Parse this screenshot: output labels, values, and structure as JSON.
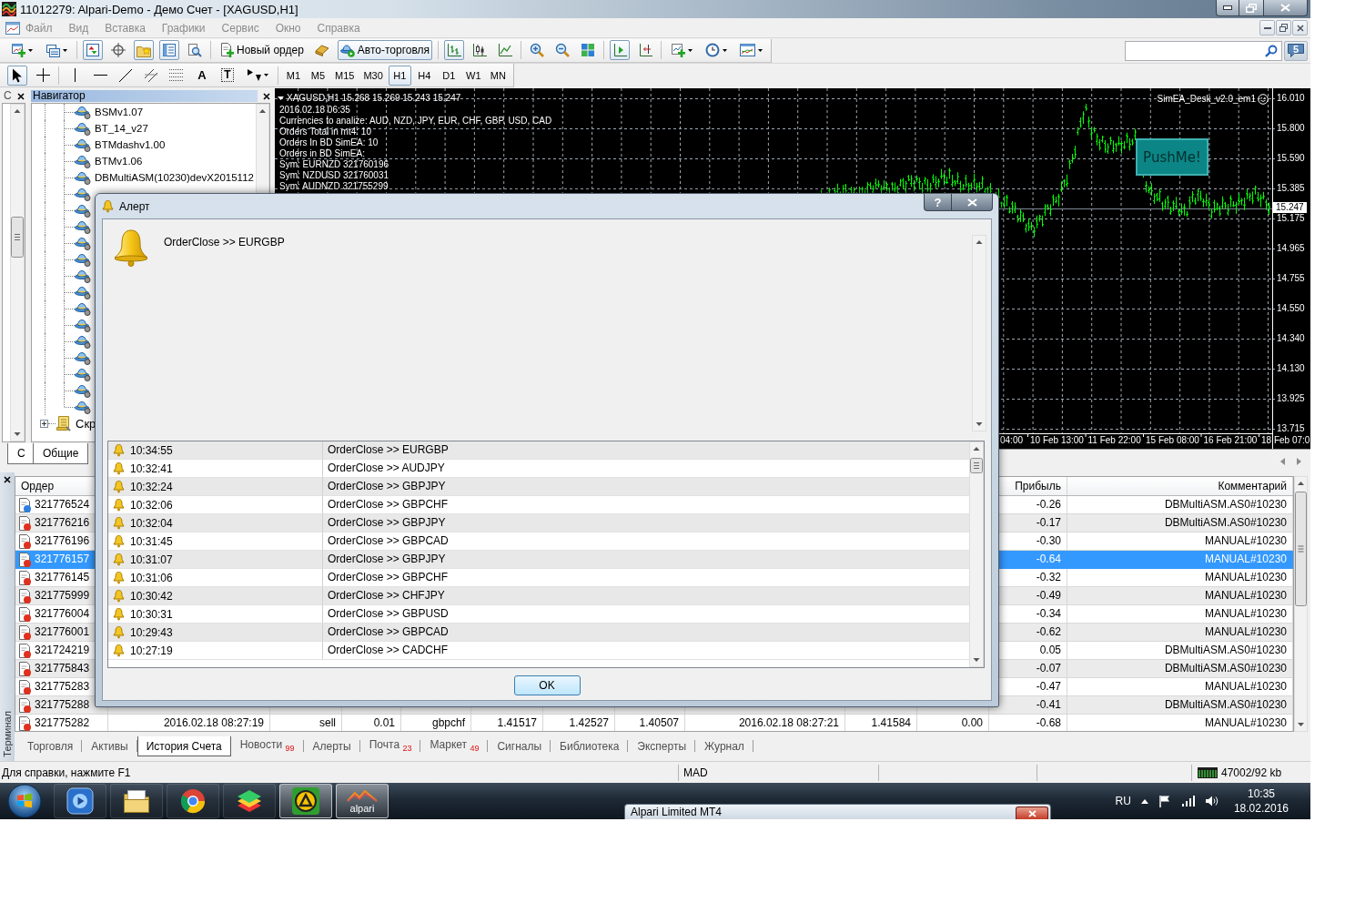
{
  "window": {
    "title": "11012279: Alpari-Demo - Демо Счет - [XAGUSD,H1]"
  },
  "menu": [
    {
      "label": "Файл",
      "disabled": true
    },
    {
      "label": "Вид",
      "disabled": true
    },
    {
      "label": "Вставка",
      "disabled": true
    },
    {
      "label": "Графики",
      "disabled": true
    },
    {
      "label": "Сервис",
      "disabled": true
    },
    {
      "label": "Окно",
      "disabled": true
    },
    {
      "label": "Справка",
      "disabled": true
    }
  ],
  "toolbar": {
    "view_toggles": [
      {
        "on": true
      },
      {
        "on": false
      },
      {
        "on": true
      },
      {
        "on": true
      },
      {
        "on": false
      }
    ],
    "new_order": "Новый ордер",
    "auto_trading": {
      "label": "Авто-торговля",
      "on": true
    },
    "chart_types": [
      {
        "selected": true
      },
      {
        "selected": false
      },
      {
        "selected": false
      }
    ],
    "auto_scroll": {
      "on": true
    },
    "chart_shift": {
      "on": false
    },
    "messages": "5"
  },
  "drawing_tools": [
    {
      "kind": "cursor",
      "selected": true
    },
    {
      "kind": "crosshair",
      "selected": false
    },
    {
      "kind": "vertical-line",
      "selected": false
    },
    {
      "kind": "horizontal-line",
      "selected": false
    },
    {
      "kind": "trend-line",
      "selected": false
    },
    {
      "kind": "channel",
      "selected": false
    },
    {
      "kind": "fibo",
      "selected": false
    },
    {
      "kind": "text",
      "label": "A",
      "selected": false
    },
    {
      "kind": "label",
      "label": "T",
      "selected": false
    },
    {
      "kind": "arrows",
      "selected": false
    }
  ],
  "timeframes": [
    {
      "label": "M1",
      "selected": false
    },
    {
      "label": "M5",
      "selected": false
    },
    {
      "label": "M15",
      "selected": false
    },
    {
      "label": "M30",
      "selected": false
    },
    {
      "label": "H1",
      "selected": true
    },
    {
      "label": "H4",
      "selected": false
    },
    {
      "label": "D1",
      "selected": false
    },
    {
      "label": "W1",
      "selected": false
    },
    {
      "label": "MN",
      "selected": false
    }
  ],
  "market_watch": {
    "title": "С",
    "tabs": [
      {
        "label": "С",
        "selected": true
      }
    ]
  },
  "navigator": {
    "title": "Навигатор",
    "items": [
      {
        "kind": "expert",
        "label": "BSMv1.07"
      },
      {
        "kind": "expert",
        "label": "BT_14_v27"
      },
      {
        "kind": "expert",
        "label": "BTMdashv1.00"
      },
      {
        "kind": "expert",
        "label": "BTMv1.06"
      },
      {
        "kind": "expert",
        "label": "DBMultiASM(10230)devX2015112"
      },
      {
        "kind": "expert"
      },
      {
        "kind": "expert"
      },
      {
        "kind": "expert"
      },
      {
        "kind": "expert"
      },
      {
        "kind": "expert"
      },
      {
        "kind": "expert"
      },
      {
        "kind": "expert"
      },
      {
        "kind": "expert"
      },
      {
        "kind": "expert"
      },
      {
        "kind": "expert"
      },
      {
        "kind": "expert"
      },
      {
        "kind": "expert"
      },
      {
        "kind": "expert"
      },
      {
        "kind": "expert"
      },
      {
        "kind": "folder",
        "label": "Скр",
        "expanded": false
      }
    ],
    "tabs": [
      {
        "label": "Общие",
        "selected": true
      }
    ]
  },
  "chart": {
    "header": "XAGUSD,H1 15.268 15.269 15.243 15.247",
    "info_lines": [
      "2016.02.18 06:35",
      "Currencies to analize: AUD, NZD, JPY, EUR, CHF, GBP, USD, CAD",
      "Orders Total in mt4: 10",
      "Orders In BD SimEA: 10",
      "Orders in BD SimEA:",
      "Sym: EURNZD 321760196",
      "Sym: NZDUSD 321760031",
      "Sym: AUDNZD 321755299"
    ],
    "expert": "SimEA_Desk_v2.0_em1",
    "button": "PushMe!",
    "price_labels": [
      "16.010",
      "15.800",
      "15.590",
      "15.385",
      "15.175",
      "14.965",
      "14.755",
      "14.550",
      "14.340",
      "14.130",
      "13.925",
      "13.715"
    ],
    "current_price": "15.247",
    "time_labels": [
      "04:00",
      "10 Feb 13:00",
      "11 Feb 22:00",
      "15 Feb 08:00",
      "16 Feb 21:00",
      "18 Feb 07:0"
    ]
  },
  "terminal": {
    "label": "Терминал",
    "columns": {
      "order": "Ордер",
      "profit": "Прибыль",
      "comment": "Комментарий"
    },
    "rows": [
      {
        "order": "321776524",
        "color": "#2f7fe0",
        "profit": "-0.26",
        "comment": "DBMultiASM.AS0#10230",
        "selected": false
      },
      {
        "order": "321776216",
        "color": "#e0301e",
        "profit": "-0.17",
        "comment": "DBMultiASM.AS0#10230",
        "selected": false
      },
      {
        "order": "321776196",
        "color": "#e0301e",
        "profit": "-0.30",
        "comment": "MANUAL#10230",
        "selected": false
      },
      {
        "order": "321776157",
        "color": "#e0301e",
        "profit": "-0.64",
        "comment": "MANUAL#10230",
        "selected": true
      },
      {
        "order": "321776145",
        "color": "#e0301e",
        "profit": "-0.32",
        "comment": "MANUAL#10230",
        "selected": false
      },
      {
        "order": "321775999",
        "color": "#e0301e",
        "profit": "-0.49",
        "comment": "MANUAL#10230",
        "selected": false
      },
      {
        "order": "321776004",
        "color": "#e0301e",
        "profit": "-0.34",
        "comment": "MANUAL#10230",
        "selected": false
      },
      {
        "order": "321776001",
        "color": "#e0301e",
        "profit": "-0.62",
        "comment": "MANUAL#10230",
        "selected": false
      },
      {
        "order": "321724219",
        "color": "#e0301e",
        "profit": "0.05",
        "comment": "DBMultiASM.AS0#10230",
        "selected": false
      },
      {
        "order": "321775843",
        "color": "#e0301e",
        "profit": "-0.07",
        "comment": "DBMultiASM.AS0#10230",
        "selected": false
      },
      {
        "order": "321775283",
        "color": "#e0301e",
        "profit": "-0.47",
        "comment": "MANUAL#10230",
        "selected": false
      },
      {
        "order": "321775288",
        "color": "#e0301e",
        "profit": "-0.41",
        "comment": "DBMultiASM.AS0#10230",
        "selected": false
      },
      {
        "order": "321775282",
        "color": "#e0301e",
        "column_2": "2016.02.18 08:27:19",
        "column_3": "sell",
        "column_4": "0.01",
        "column_5": "gbpchf",
        "column_6": "1.41517",
        "column_7": "1.42527",
        "column_8": "1.40507",
        "column_9": "2016.02.18 08:27:21",
        "column_10": "1.41584",
        "column_11": "0.00",
        "profit": "-0.68",
        "comment": "MANUAL#10230",
        "selected": false
      }
    ],
    "tabs": [
      {
        "label": "Торговля",
        "selected": false
      },
      {
        "label": "Активы",
        "selected": false
      },
      {
        "label": "История Счета",
        "selected": true
      },
      {
        "label": "Новости",
        "count": "99",
        "selected": false
      },
      {
        "label": "Алерты",
        "selected": false
      },
      {
        "label": "Почта",
        "count": "23",
        "selected": false
      },
      {
        "label": "Маркет",
        "count": "49",
        "selected": false
      },
      {
        "label": "Сигналы",
        "selected": false
      },
      {
        "label": "Библиотека",
        "selected": false
      },
      {
        "label": "Эксперты",
        "selected": false
      },
      {
        "label": "Журнал",
        "selected": false
      }
    ]
  },
  "alert": {
    "title": "Алерт",
    "help": "?",
    "message": "OrderClose >> EURGBP",
    "rows": [
      {
        "time": "10:34:55",
        "text": "OrderClose >> EURGBP"
      },
      {
        "time": "10:32:41",
        "text": "OrderClose >> AUDJPY"
      },
      {
        "time": "10:32:24",
        "text": "OrderClose >> GBPJPY"
      },
      {
        "time": "10:32:06",
        "text": "OrderClose >> GBPCHF"
      },
      {
        "time": "10:32:04",
        "text": "OrderClose >> GBPJPY"
      },
      {
        "time": "10:31:45",
        "text": "OrderClose >> GBPCAD"
      },
      {
        "time": "10:31:07",
        "text": "OrderClose >> GBPJPY"
      },
      {
        "time": "10:31:06",
        "text": "OrderClose >> GBPCHF"
      },
      {
        "time": "10:30:42",
        "text": "OrderClose >> CHFJPY"
      },
      {
        "time": "10:30:31",
        "text": "OrderClose >> GBPUSD"
      },
      {
        "time": "10:29:43",
        "text": "OrderClose >> GBPCAD"
      },
      {
        "time": "10:27:19",
        "text": "OrderClose >> CADCHF"
      }
    ],
    "ok": "OK"
  },
  "status_bar": {
    "help": "Для справки, нажмите F1",
    "profile": "MAD",
    "traffic": "47002/92 kb"
  },
  "taskbar": {
    "apps": [
      {
        "kind": "media",
        "selected": false
      },
      {
        "kind": "files",
        "selected": false
      },
      {
        "kind": "browser",
        "selected": false
      },
      {
        "kind": "stack",
        "selected": false
      },
      {
        "kind": "terminal",
        "selected": true
      },
      {
        "kind": "alpari",
        "label": "alpari",
        "selected": true
      }
    ],
    "preview_title": "Alpari Limited MT4",
    "language": "RU",
    "time": "10:35",
    "date": "18.02.2016"
  }
}
